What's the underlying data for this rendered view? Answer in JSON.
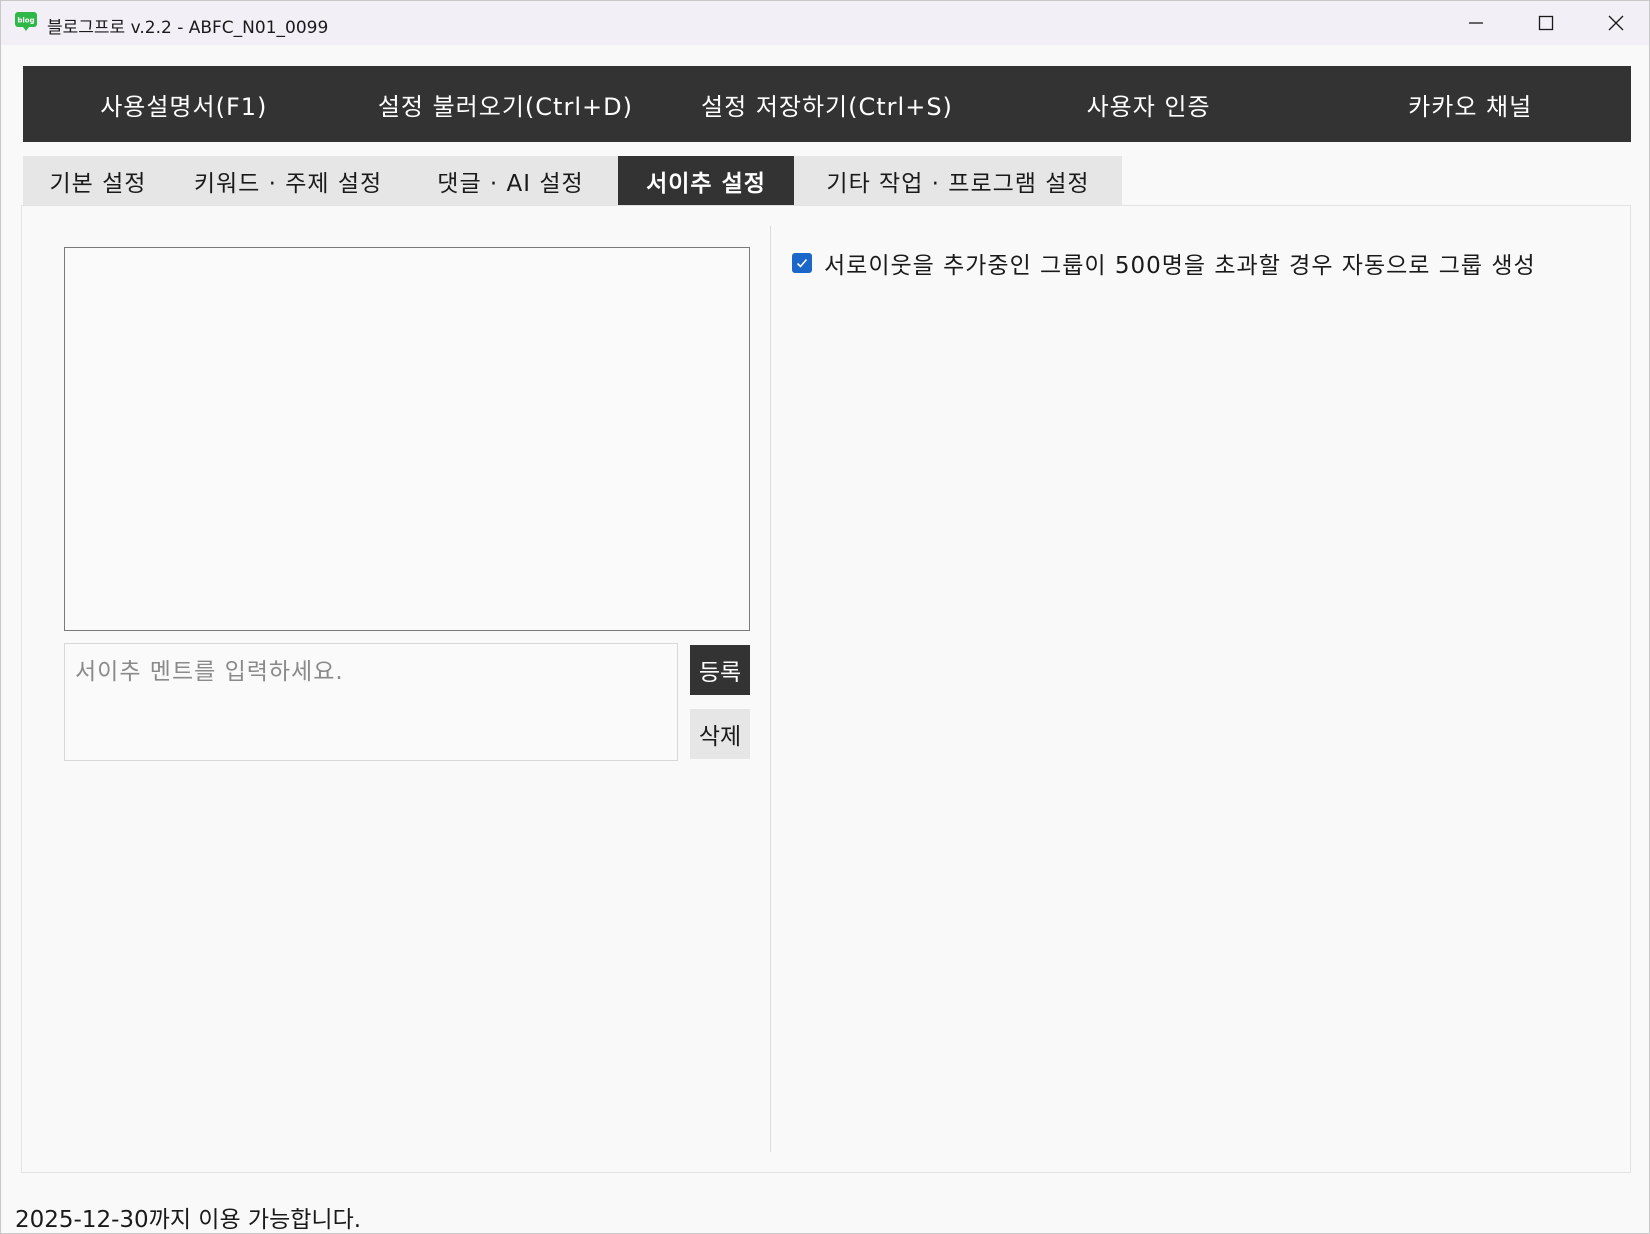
{
  "window": {
    "title": "블로그프로 v.2.2 - ABFC_N01_0099",
    "app_icon_text": "blog"
  },
  "menu": {
    "items": [
      {
        "label": "사용설명서(F1)"
      },
      {
        "label": "설정 불러오기(Ctrl+D)"
      },
      {
        "label": "설정 저장하기(Ctrl+S)"
      },
      {
        "label": "사용자 인증"
      },
      {
        "label": "카카오 채널"
      }
    ]
  },
  "tabs": {
    "items": [
      {
        "label": "기본 설정",
        "active": false
      },
      {
        "label": "키워드 · 주제 설정",
        "active": false
      },
      {
        "label": "댓글 · AI 설정",
        "active": false
      },
      {
        "label": "서이추 설정",
        "active": true
      },
      {
        "label": "기타 작업 · 프로그램 설정",
        "active": false
      }
    ]
  },
  "neighbor_settings": {
    "comment_input": {
      "value": "",
      "placeholder": "서이추 멘트를 입력하세요."
    },
    "register_label": "등록",
    "delete_label": "삭제",
    "auto_group_checkbox": {
      "checked": true,
      "label": "서로이웃을 추가중인 그룹이 500명을 초과할 경우 자동으로 그룹 생성"
    }
  },
  "status": {
    "text": "2025-12-30까지 이용 가능합니다."
  },
  "colors": {
    "menu_bg": "#333333",
    "tab_active_bg": "#333333",
    "tab_inactive_bg": "#e6e6e6",
    "checkbox_accent": "#1a66c9",
    "app_icon_green": "#2fb84a"
  }
}
